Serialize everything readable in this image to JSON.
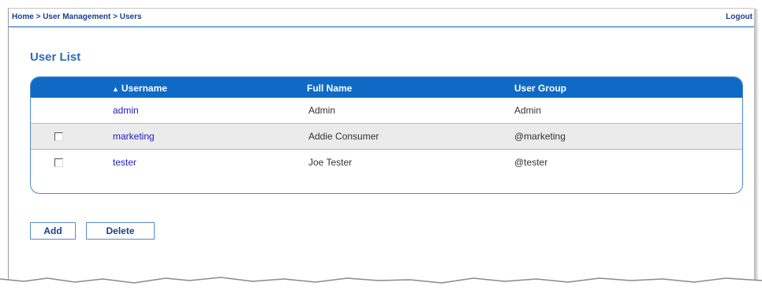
{
  "breadcrumb": {
    "home": "Home",
    "sep1": " > ",
    "section": "User Management",
    "sep2": " > ",
    "current": "Users"
  },
  "logout_label": "Logout",
  "page_title": "User List",
  "table": {
    "headers": {
      "sort_arrow": "▲",
      "username": "Username",
      "fullname": "Full Name",
      "group": "User Group"
    },
    "rows": [
      {
        "username": "admin",
        "fullname": "Admin",
        "group": "Admin",
        "checkbox": false
      },
      {
        "username": "marketing",
        "fullname": "Addie Consumer",
        "group": "@marketing",
        "checkbox": true
      },
      {
        "username": "tester",
        "fullname": "Joe Tester",
        "group": "@tester",
        "checkbox": true
      }
    ]
  },
  "buttons": {
    "add": "Add",
    "delete": "Delete"
  },
  "colors": {
    "header_bg": "#0f6ac6",
    "link": "#2020c0",
    "title": "#2d6bb6",
    "alt_row": "#ebebeb"
  }
}
